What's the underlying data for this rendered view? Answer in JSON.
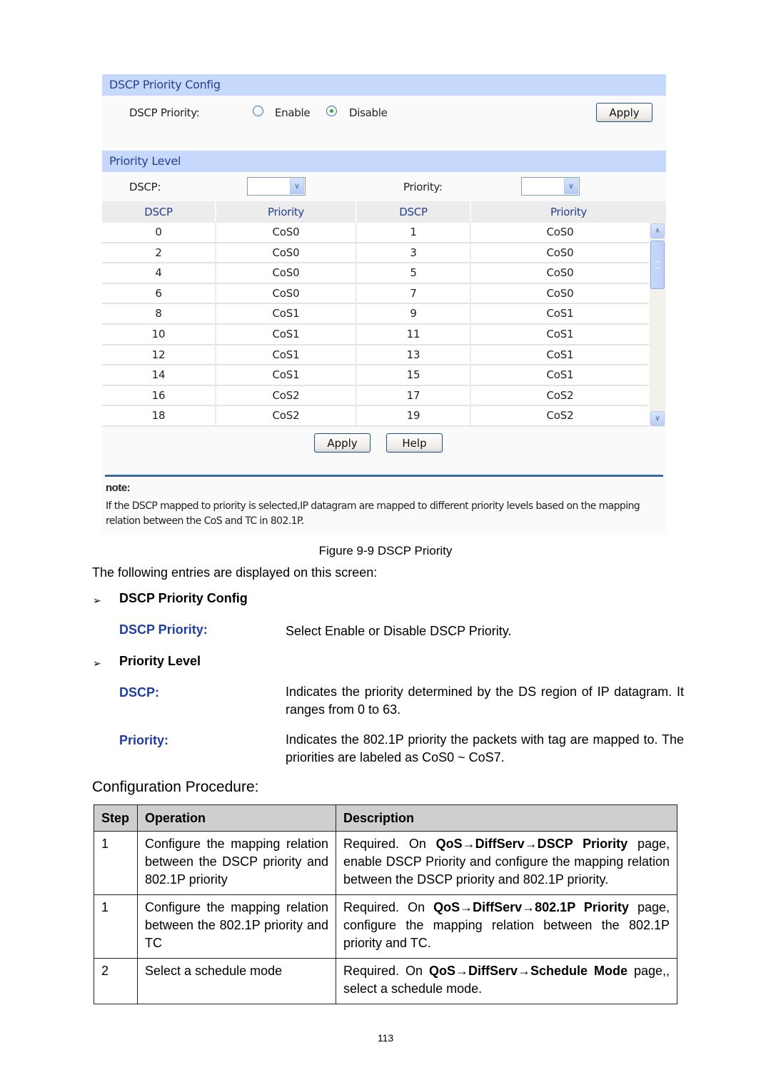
{
  "figure": {
    "config_section": {
      "title": "DSCP Priority Config",
      "field_label": "DSCP Priority:",
      "options": [
        {
          "label": "Enable",
          "checked": false
        },
        {
          "label": "Disable",
          "checked": true
        }
      ],
      "apply_label": "Apply"
    },
    "level_section": {
      "title": "Priority Level",
      "dscp_label": "DSCP:",
      "dscp_value": "",
      "priority_label": "Priority:",
      "priority_value": ""
    },
    "grid": {
      "headers": [
        "DSCP",
        "Priority",
        "DSCP",
        "Priority"
      ],
      "rows": [
        [
          "0",
          "CoS0",
          "1",
          "CoS0"
        ],
        [
          "2",
          "CoS0",
          "3",
          "CoS0"
        ],
        [
          "4",
          "CoS0",
          "5",
          "CoS0"
        ],
        [
          "6",
          "CoS0",
          "7",
          "CoS0"
        ],
        [
          "8",
          "CoS1",
          "9",
          "CoS1"
        ],
        [
          "10",
          "CoS1",
          "11",
          "CoS1"
        ],
        [
          "12",
          "CoS1",
          "13",
          "CoS1"
        ],
        [
          "14",
          "CoS1",
          "15",
          "CoS1"
        ],
        [
          "16",
          "CoS2",
          "17",
          "CoS2"
        ],
        [
          "18",
          "CoS2",
          "19",
          "CoS2"
        ]
      ],
      "scroll_up_icon": "chevron-up-icon",
      "scroll_down_icon": "chevron-down-icon"
    },
    "buttons": {
      "apply": "Apply",
      "help": "Help"
    },
    "note": {
      "title": "note:",
      "text": "If the DSCP mapped to priority is selected,IP datagram are mapped to different priority levels based on the mapping relation between the CoS and TC in 802.1P."
    },
    "colors": {
      "section_bar": "#c6d9fc",
      "section_text": "#24418c",
      "note_rule": "#3d6aa6"
    }
  },
  "doc": {
    "caption": "Figure 9-9 DSCP Priority",
    "intro": "The following entries are displayed on this screen:",
    "bullet_glyph": "➢",
    "sections": [
      {
        "heading": "DSCP Priority Config",
        "entries": [
          {
            "term": "DSCP Priority:",
            "desc": "Select Enable or Disable DSCP Priority."
          }
        ]
      },
      {
        "heading": "Priority Level",
        "entries": [
          {
            "term": "DSCP:",
            "desc": "Indicates the priority determined by the DS region of IP datagram. It ranges from 0 to 63."
          },
          {
            "term": "Priority:",
            "desc": "Indicates the 802.1P priority the packets with tag are mapped to. The priorities are labeled as CoS0 ~ CoS7."
          }
        ]
      }
    ],
    "procedure": {
      "heading": "Configuration Procedure:",
      "headers": [
        "Step",
        "Operation",
        "Description"
      ],
      "rows": [
        {
          "step": "1",
          "operation": "Configure the mapping relation between the DSCP priority and 802.1P priority",
          "desc_pre": "Required. On ",
          "desc_bold": "QoS→DiffServ→DSCP Priority",
          "desc_post": " page, enable DSCP Priority and configure the mapping relation between the DSCP priority and 802.1P priority."
        },
        {
          "step": "1",
          "operation": "Configure the mapping relation between the 802.1P priority and TC",
          "desc_pre": "Required. On ",
          "desc_bold": "QoS→DiffServ→802.1P Priority",
          "desc_post": " page, configure the mapping relation between the 802.1P priority and TC."
        },
        {
          "step": "2",
          "operation": "Select a schedule mode",
          "desc_pre": "Required. On ",
          "desc_bold": "QoS→DiffServ→Schedule Mode",
          "desc_post": " page,, select a schedule mode."
        }
      ]
    },
    "page_number": "113"
  }
}
